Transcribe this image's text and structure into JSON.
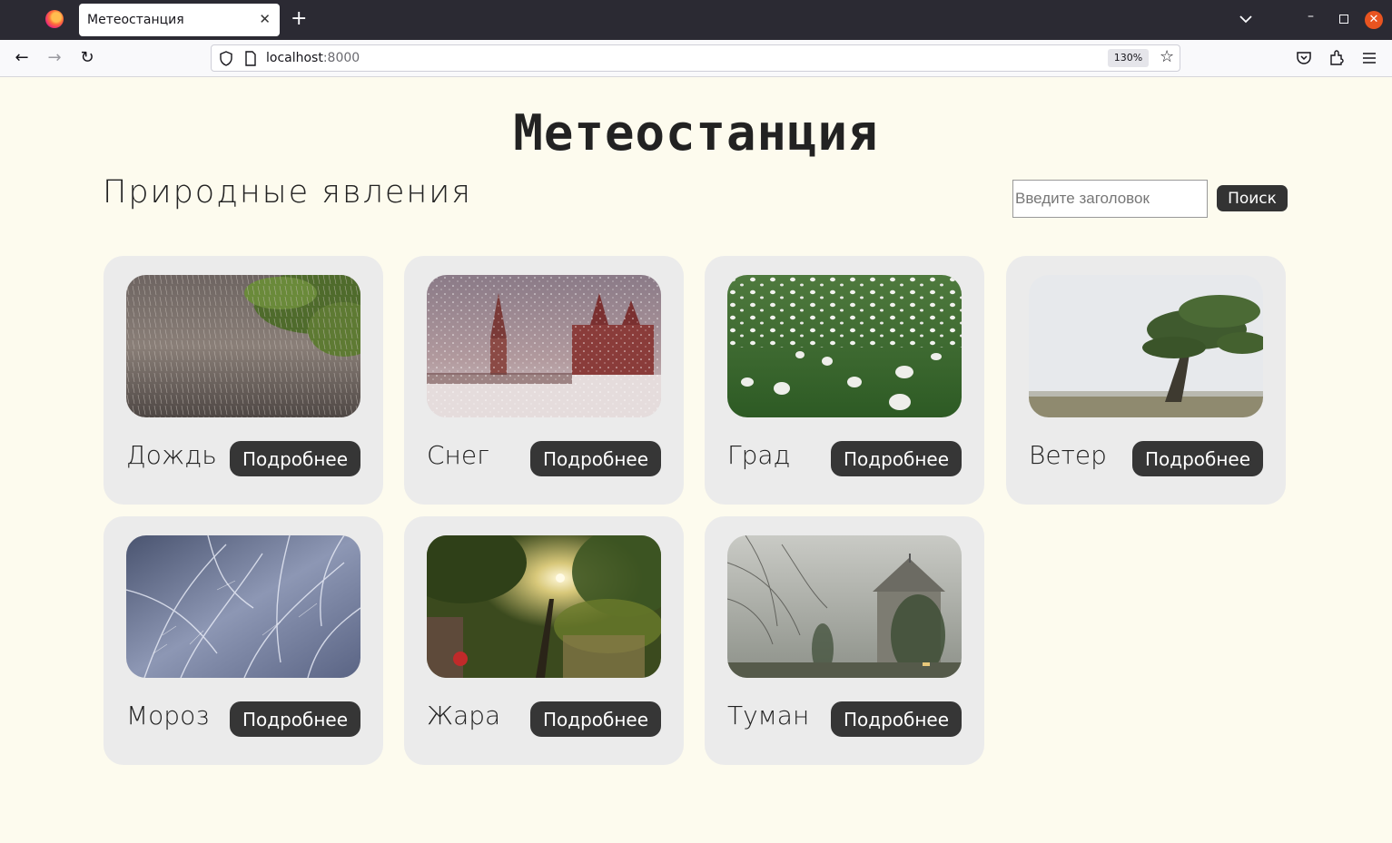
{
  "browser": {
    "tab_title": "Метеостанция",
    "url_host": "localhost",
    "url_port": ":8000",
    "zoom": "130%"
  },
  "page": {
    "title": "Метеостанция",
    "section_title": "Природные явления",
    "search": {
      "placeholder": "Введите заголовок",
      "button": "Поиск"
    },
    "cards": [
      {
        "name": "Дождь",
        "button": "Подробнее",
        "image": "rain"
      },
      {
        "name": "Снег",
        "button": "Подробнее",
        "image": "snow"
      },
      {
        "name": "Град",
        "button": "Подробнее",
        "image": "hail"
      },
      {
        "name": "Ветер",
        "button": "Подробнее",
        "image": "wind"
      },
      {
        "name": "Мороз",
        "button": "Подробнее",
        "image": "frost"
      },
      {
        "name": "Жара",
        "button": "Подробнее",
        "image": "heat"
      },
      {
        "name": "Туман",
        "button": "Подробнее",
        "image": "fog"
      }
    ]
  }
}
